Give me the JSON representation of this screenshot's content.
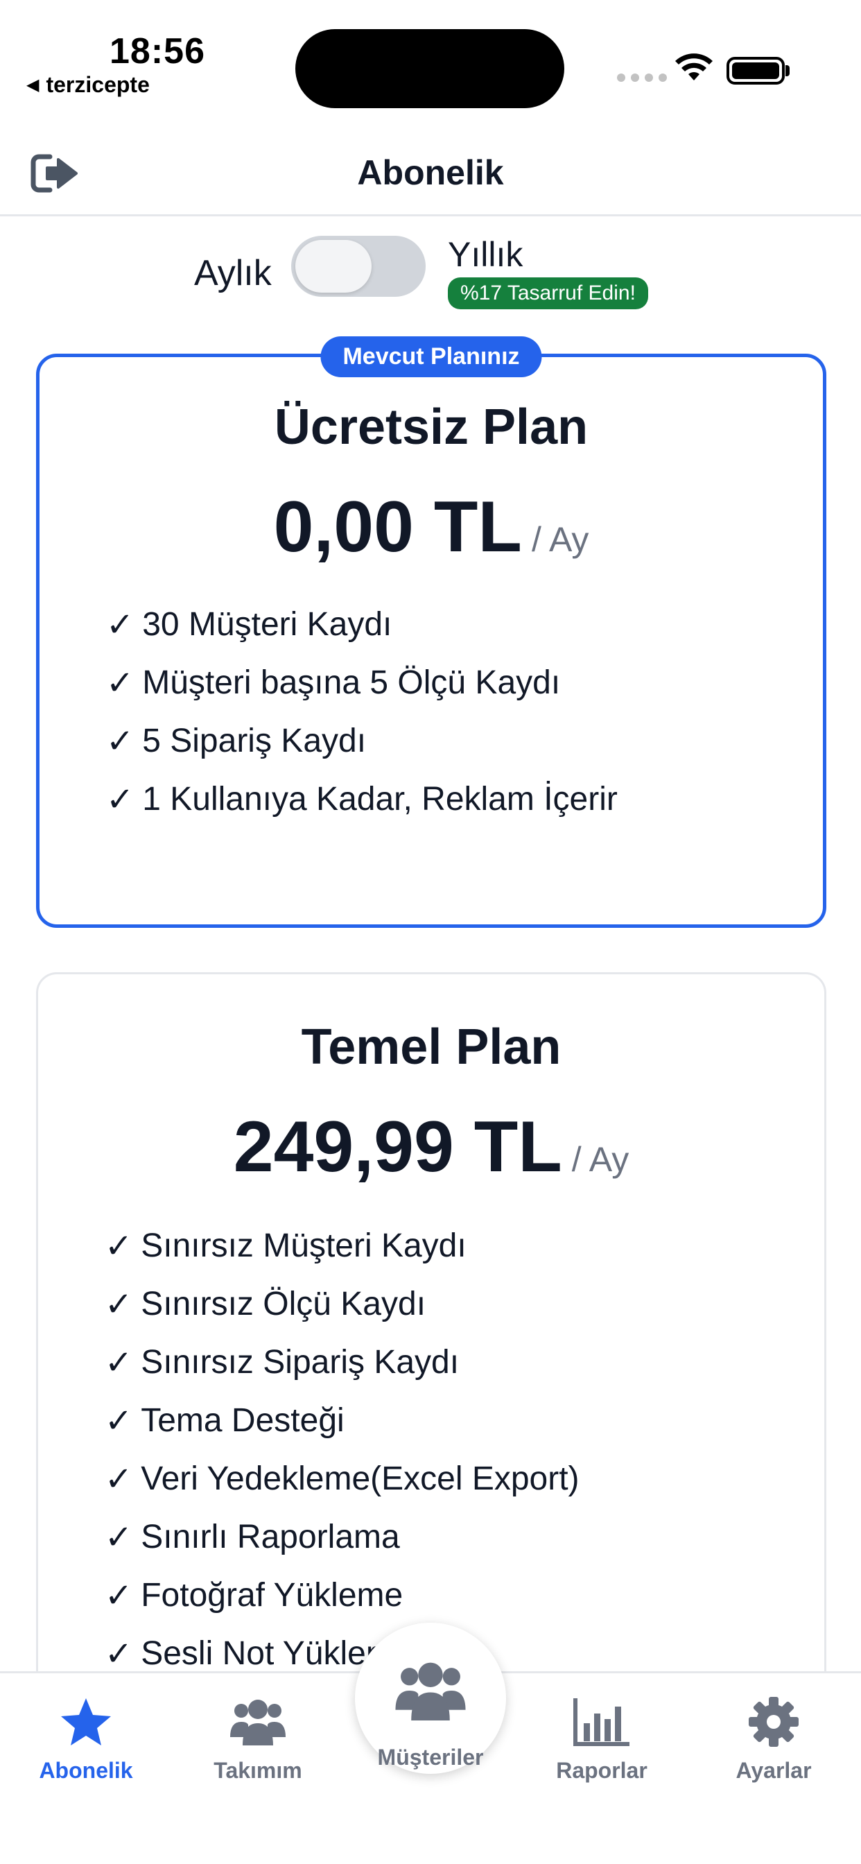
{
  "status_bar": {
    "time": "18:56",
    "back_app": "terzicepte",
    "back_icon": "triangle-left-icon"
  },
  "header": {
    "title": "Abonelik",
    "logout_icon": "logout-icon"
  },
  "billing": {
    "monthly_label": "Aylık",
    "yearly_label": "Yıllık",
    "savings_badge": "%17 Tasarruf Edin!",
    "selected": "monthly"
  },
  "plans": [
    {
      "current_badge": "Mevcut Planınız",
      "name": "Ücretsiz Plan",
      "price": "0,00 TL",
      "period": "/ Ay",
      "features": [
        "30 Müşteri Kaydı",
        "Müşteri başına 5 Ölçü Kaydı",
        "5 Sipariş Kaydı",
        "1 Kullanıya Kadar, Reklam İçerir"
      ]
    },
    {
      "name": "Temel Plan",
      "price": "249,99 TL",
      "period": "/ Ay",
      "features": [
        "Sınırsız Müşteri Kaydı",
        "Sınırsız Ölçü Kaydı",
        "Sınırsız Sipariş Kaydı",
        "Tema Desteği",
        "Veri Yedekleme(Excel Export)",
        "Sınırlı Raporlama",
        "Fotoğraf Yükleme",
        "Sesli Not Yükleme"
      ]
    }
  ],
  "check_glyph": "✓",
  "tabs": [
    {
      "label": "Abonelik",
      "icon": "star-icon",
      "active": true
    },
    {
      "label": "Takımım",
      "icon": "users-icon",
      "active": false
    },
    {
      "label": "Müşteriler",
      "icon": "users-icon",
      "active": false
    },
    {
      "label": "Raporlar",
      "icon": "bar-chart-icon",
      "active": false
    },
    {
      "label": "Ayarlar",
      "icon": "gear-icon",
      "active": false
    }
  ],
  "colors": {
    "accent": "#2563eb",
    "savings_green": "#15803d",
    "muted": "#6b7280",
    "text": "#111827"
  }
}
